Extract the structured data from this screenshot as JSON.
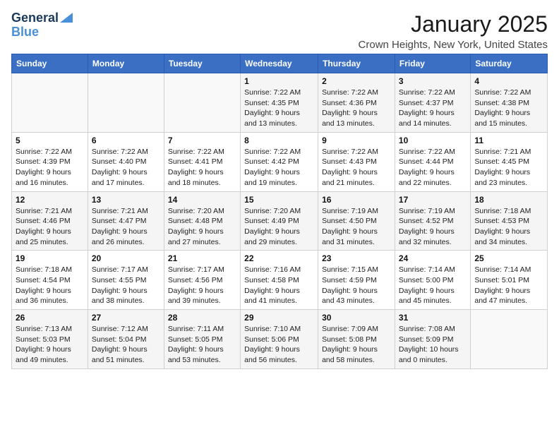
{
  "header": {
    "logo_line1": "General",
    "logo_line2": "Blue",
    "title": "January 2025",
    "subtitle": "Crown Heights, New York, United States"
  },
  "weekdays": [
    "Sunday",
    "Monday",
    "Tuesday",
    "Wednesday",
    "Thursday",
    "Friday",
    "Saturday"
  ],
  "weeks": [
    [
      {
        "day": "",
        "info": ""
      },
      {
        "day": "",
        "info": ""
      },
      {
        "day": "",
        "info": ""
      },
      {
        "day": "1",
        "info": "Sunrise: 7:22 AM\nSunset: 4:35 PM\nDaylight: 9 hours and 13 minutes."
      },
      {
        "day": "2",
        "info": "Sunrise: 7:22 AM\nSunset: 4:36 PM\nDaylight: 9 hours and 13 minutes."
      },
      {
        "day": "3",
        "info": "Sunrise: 7:22 AM\nSunset: 4:37 PM\nDaylight: 9 hours and 14 minutes."
      },
      {
        "day": "4",
        "info": "Sunrise: 7:22 AM\nSunset: 4:38 PM\nDaylight: 9 hours and 15 minutes."
      }
    ],
    [
      {
        "day": "5",
        "info": "Sunrise: 7:22 AM\nSunset: 4:39 PM\nDaylight: 9 hours and 16 minutes."
      },
      {
        "day": "6",
        "info": "Sunrise: 7:22 AM\nSunset: 4:40 PM\nDaylight: 9 hours and 17 minutes."
      },
      {
        "day": "7",
        "info": "Sunrise: 7:22 AM\nSunset: 4:41 PM\nDaylight: 9 hours and 18 minutes."
      },
      {
        "day": "8",
        "info": "Sunrise: 7:22 AM\nSunset: 4:42 PM\nDaylight: 9 hours and 19 minutes."
      },
      {
        "day": "9",
        "info": "Sunrise: 7:22 AM\nSunset: 4:43 PM\nDaylight: 9 hours and 21 minutes."
      },
      {
        "day": "10",
        "info": "Sunrise: 7:22 AM\nSunset: 4:44 PM\nDaylight: 9 hours and 22 minutes."
      },
      {
        "day": "11",
        "info": "Sunrise: 7:21 AM\nSunset: 4:45 PM\nDaylight: 9 hours and 23 minutes."
      }
    ],
    [
      {
        "day": "12",
        "info": "Sunrise: 7:21 AM\nSunset: 4:46 PM\nDaylight: 9 hours and 25 minutes."
      },
      {
        "day": "13",
        "info": "Sunrise: 7:21 AM\nSunset: 4:47 PM\nDaylight: 9 hours and 26 minutes."
      },
      {
        "day": "14",
        "info": "Sunrise: 7:20 AM\nSunset: 4:48 PM\nDaylight: 9 hours and 27 minutes."
      },
      {
        "day": "15",
        "info": "Sunrise: 7:20 AM\nSunset: 4:49 PM\nDaylight: 9 hours and 29 minutes."
      },
      {
        "day": "16",
        "info": "Sunrise: 7:19 AM\nSunset: 4:50 PM\nDaylight: 9 hours and 31 minutes."
      },
      {
        "day": "17",
        "info": "Sunrise: 7:19 AM\nSunset: 4:52 PM\nDaylight: 9 hours and 32 minutes."
      },
      {
        "day": "18",
        "info": "Sunrise: 7:18 AM\nSunset: 4:53 PM\nDaylight: 9 hours and 34 minutes."
      }
    ],
    [
      {
        "day": "19",
        "info": "Sunrise: 7:18 AM\nSunset: 4:54 PM\nDaylight: 9 hours and 36 minutes."
      },
      {
        "day": "20",
        "info": "Sunrise: 7:17 AM\nSunset: 4:55 PM\nDaylight: 9 hours and 38 minutes."
      },
      {
        "day": "21",
        "info": "Sunrise: 7:17 AM\nSunset: 4:56 PM\nDaylight: 9 hours and 39 minutes."
      },
      {
        "day": "22",
        "info": "Sunrise: 7:16 AM\nSunset: 4:58 PM\nDaylight: 9 hours and 41 minutes."
      },
      {
        "day": "23",
        "info": "Sunrise: 7:15 AM\nSunset: 4:59 PM\nDaylight: 9 hours and 43 minutes."
      },
      {
        "day": "24",
        "info": "Sunrise: 7:14 AM\nSunset: 5:00 PM\nDaylight: 9 hours and 45 minutes."
      },
      {
        "day": "25",
        "info": "Sunrise: 7:14 AM\nSunset: 5:01 PM\nDaylight: 9 hours and 47 minutes."
      }
    ],
    [
      {
        "day": "26",
        "info": "Sunrise: 7:13 AM\nSunset: 5:03 PM\nDaylight: 9 hours and 49 minutes."
      },
      {
        "day": "27",
        "info": "Sunrise: 7:12 AM\nSunset: 5:04 PM\nDaylight: 9 hours and 51 minutes."
      },
      {
        "day": "28",
        "info": "Sunrise: 7:11 AM\nSunset: 5:05 PM\nDaylight: 9 hours and 53 minutes."
      },
      {
        "day": "29",
        "info": "Sunrise: 7:10 AM\nSunset: 5:06 PM\nDaylight: 9 hours and 56 minutes."
      },
      {
        "day": "30",
        "info": "Sunrise: 7:09 AM\nSunset: 5:08 PM\nDaylight: 9 hours and 58 minutes."
      },
      {
        "day": "31",
        "info": "Sunrise: 7:08 AM\nSunset: 5:09 PM\nDaylight: 10 hours and 0 minutes."
      },
      {
        "day": "",
        "info": ""
      }
    ]
  ]
}
